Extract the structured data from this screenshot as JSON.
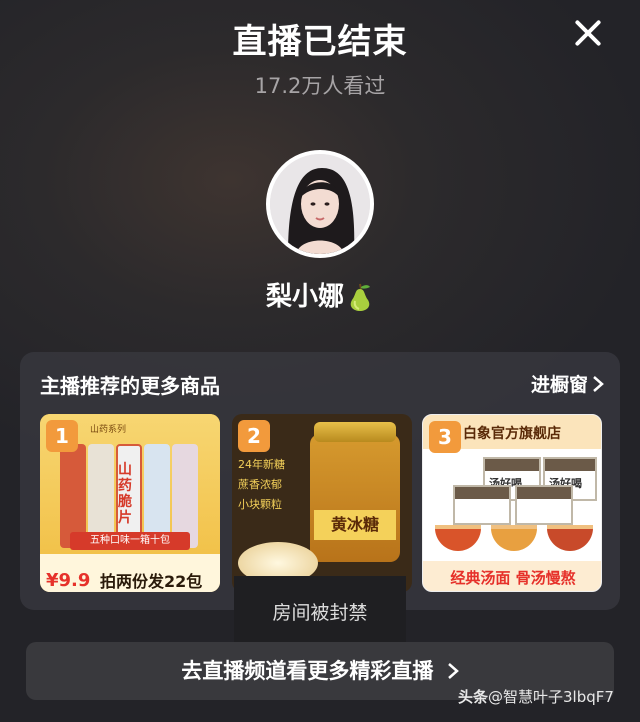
{
  "header": {
    "title": "直播已结束",
    "viewers": "17.2万人看过"
  },
  "streamer": {
    "name": "梨小娜",
    "emoji_icon": "pear-icon"
  },
  "recommend": {
    "title": "主播推荐的更多商品",
    "link_label": "进橱窗",
    "products": [
      {
        "index": "1",
        "series": "山药系列",
        "name": "山药脆片",
        "price": "9.9",
        "promo": "拍两份发22包",
        "flavors": "五种口味一箱十包"
      },
      {
        "index": "2",
        "name": "黄冰糖",
        "tags": [
          "24年新糖",
          "蔗香浓郁",
          "小块颗粒"
        ]
      },
      {
        "index": "3",
        "shop": "白象官方旗舰店",
        "box_label": "汤好喝",
        "slogan": "经典汤面 骨汤慢熬"
      }
    ]
  },
  "overlay": {
    "banned": "房间被封禁"
  },
  "footer": {
    "channel_button": "去直播频道看更多精彩直播"
  },
  "watermark": {
    "brand": "头条",
    "account": "@智慧叶子3lbqF7"
  }
}
